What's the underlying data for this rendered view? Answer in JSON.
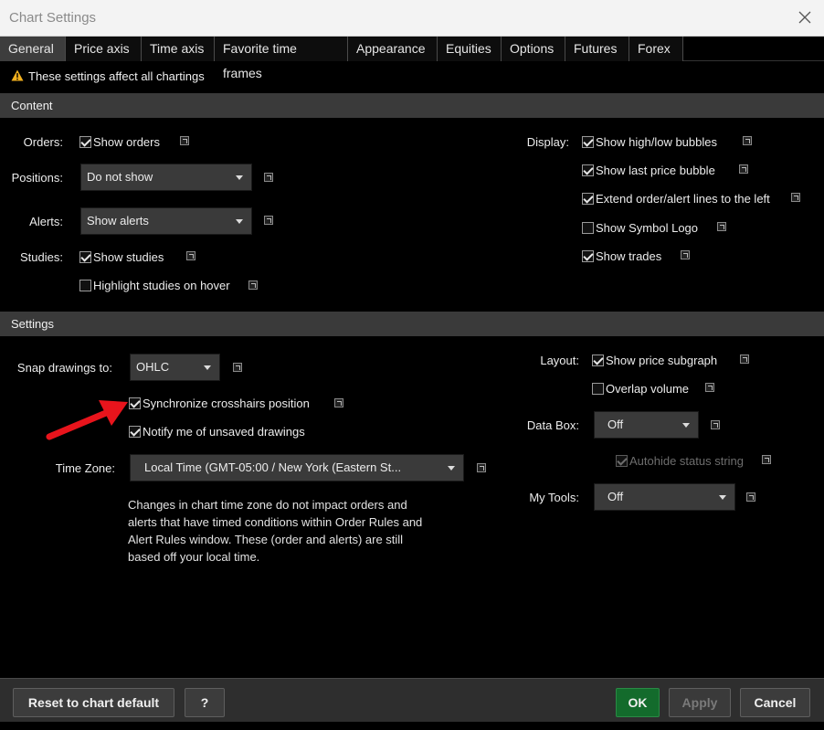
{
  "window": {
    "title": "Chart Settings"
  },
  "tabs": [
    "General",
    "Price axis",
    "Time axis",
    "Favorite time frames",
    "Appearance",
    "Equities",
    "Options",
    "Futures",
    "Forex"
  ],
  "warning": "These settings affect all chartings",
  "content": {
    "header": "Content",
    "orders_label": "Orders:",
    "show_orders": "Show orders",
    "positions_label": "Positions:",
    "positions_value": "Do not show",
    "alerts_label": "Alerts:",
    "alerts_value": "Show alerts",
    "studies_label": "Studies:",
    "show_studies": "Show studies",
    "highlight_studies": "Highlight studies on hover",
    "display_label": "Display:",
    "display_items": [
      "Show high/low bubbles",
      "Show last price bubble",
      "Extend order/alert lines to the left",
      "Show Symbol Logo",
      "Show trades"
    ]
  },
  "settings": {
    "header": "Settings",
    "snap_label": "Snap drawings to:",
    "snap_value": "OHLC",
    "sync_crosshairs": "Synchronize crosshairs position",
    "notify_unsaved": "Notify me of unsaved drawings",
    "timezone_label": "Time Zone:",
    "timezone_value": "Local Time (GMT-05:00 / New York (Eastern St...",
    "note": "Changes in chart time zone do not impact orders and alerts that have timed conditions within Order Rules and Alert Rules window. These (order and alerts) are still based off your local time.",
    "layout_label": "Layout:",
    "show_price_subgraph": "Show price subgraph",
    "overlap_volume": "Overlap volume",
    "databox_label": "Data Box:",
    "databox_value": "Off",
    "autohide_status": "Autohide status string",
    "mytools_label": "My Tools:",
    "mytools_value": "Off"
  },
  "footer": {
    "reset": "Reset to chart default",
    "help": "?",
    "ok": "OK",
    "apply": "Apply",
    "cancel": "Cancel"
  },
  "colors": {
    "ok_button": "#136b2c",
    "annotation_arrow": "#e8141c",
    "warning_icon": "#f2b01e"
  }
}
